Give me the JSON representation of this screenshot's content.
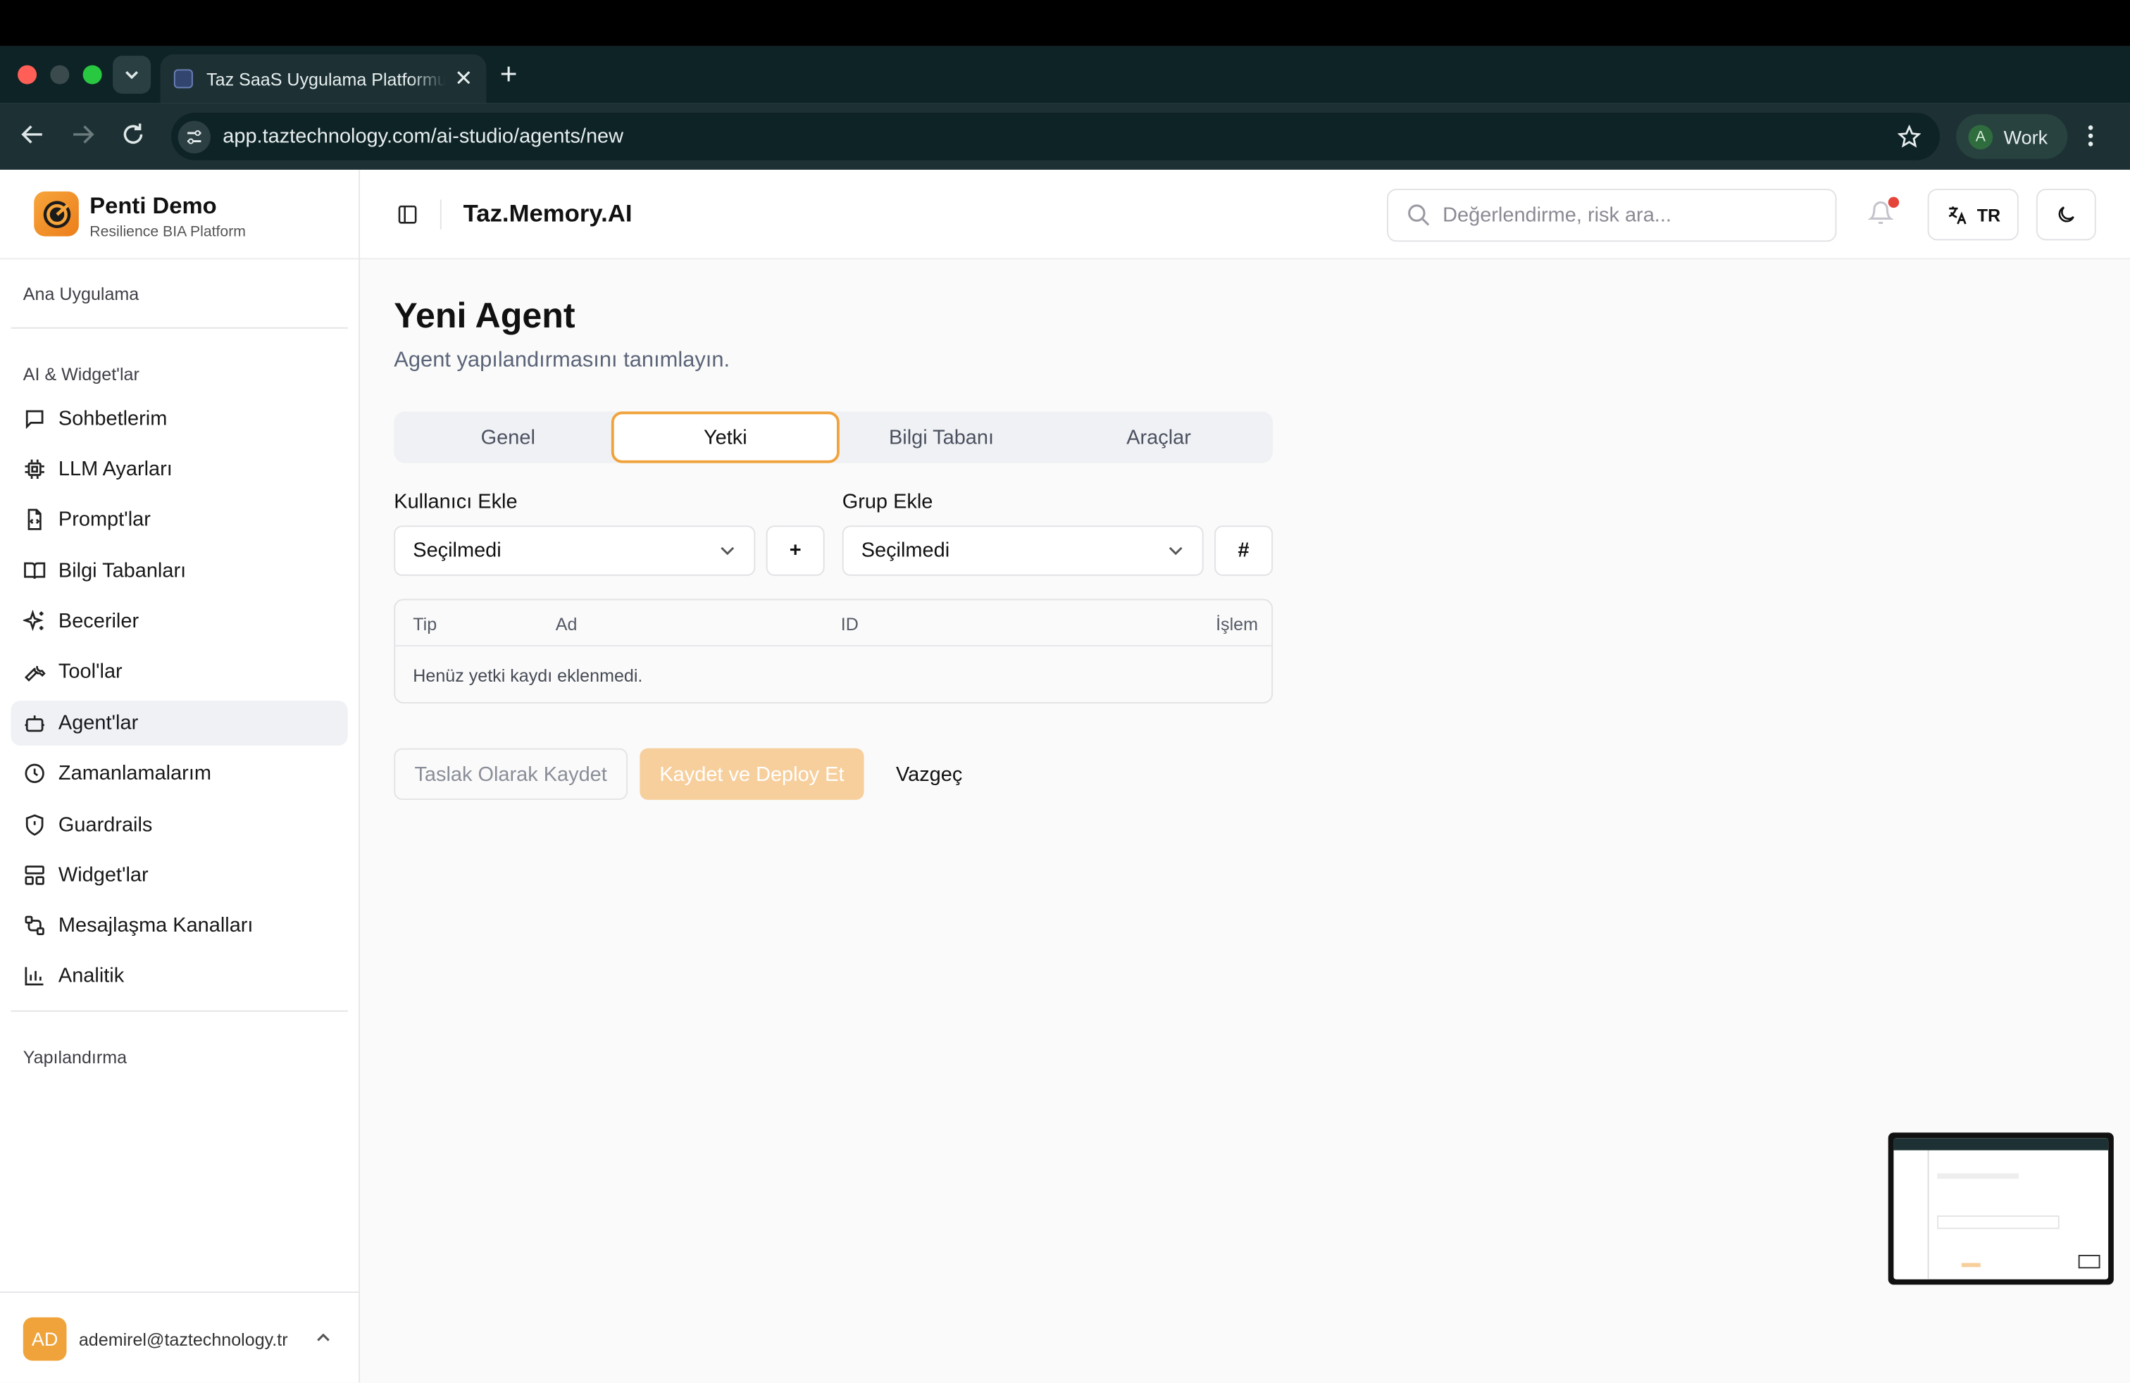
{
  "browser": {
    "tab_title": "Taz SaaS Uygulama Platformu",
    "url": "app.taztechnology.com/ai-studio/agents/new",
    "profile_initial": "A",
    "profile_name": "Work"
  },
  "sidebar": {
    "brand_name": "Penti Demo",
    "brand_sub": "Resilience BIA Platform",
    "group_main": "Ana Uygulama",
    "group_ai": "AI & Widget'lar",
    "items": [
      {
        "label": "Sohbetlerim",
        "icon": "chat-icon"
      },
      {
        "label": "LLM Ayarları",
        "icon": "cpu-icon"
      },
      {
        "label": "Prompt'lar",
        "icon": "file-code-icon"
      },
      {
        "label": "Bilgi Tabanları",
        "icon": "book-open-icon"
      },
      {
        "label": "Beceriler",
        "icon": "sparkles-icon"
      },
      {
        "label": "Tool'lar",
        "icon": "wrench-icon"
      },
      {
        "label": "Agent'lar",
        "icon": "bot-icon"
      },
      {
        "label": "Zamanlamalarım",
        "icon": "clock-icon"
      },
      {
        "label": "Guardrails",
        "icon": "shield-icon"
      },
      {
        "label": "Widget'lar",
        "icon": "layout-icon"
      },
      {
        "label": "Mesajlaşma Kanalları",
        "icon": "workflow-icon"
      },
      {
        "label": "Analitik",
        "icon": "bar-chart-icon"
      }
    ],
    "group_config": "Yapılandırma",
    "user_initials": "AD",
    "user_email": "ademirel@taztechnology.tr"
  },
  "header": {
    "title": "Taz.Memory.AI",
    "search_placeholder": "Değerlendirme, risk ara...",
    "lang": "TR"
  },
  "main": {
    "title": "Yeni Agent",
    "subtitle": "Agent yapılandırmasını tanımlayın.",
    "tabs": [
      "Genel",
      "Yetki",
      "Bilgi Tabanı",
      "Araçlar"
    ],
    "active_tab": "Yetki",
    "user_label": "Kullanıcı Ekle",
    "user_select": "Seçilmedi",
    "user_add": "+",
    "group_label": "Grup Ekle",
    "group_select": "Seçilmedi",
    "group_add": "#",
    "table_headers": [
      "Tip",
      "Ad",
      "ID",
      "İşlem"
    ],
    "table_empty": "Henüz yetki kaydı eklenmedi.",
    "btn_draft": "Taslak Olarak Kaydet",
    "btn_deploy": "Kaydet ve Deploy Et",
    "btn_cancel": "Vazgeç"
  },
  "colors": {
    "accent": "#f0a33b",
    "deploy_disabled": "#f7cf9d",
    "notification_dot": "#e5443a"
  }
}
